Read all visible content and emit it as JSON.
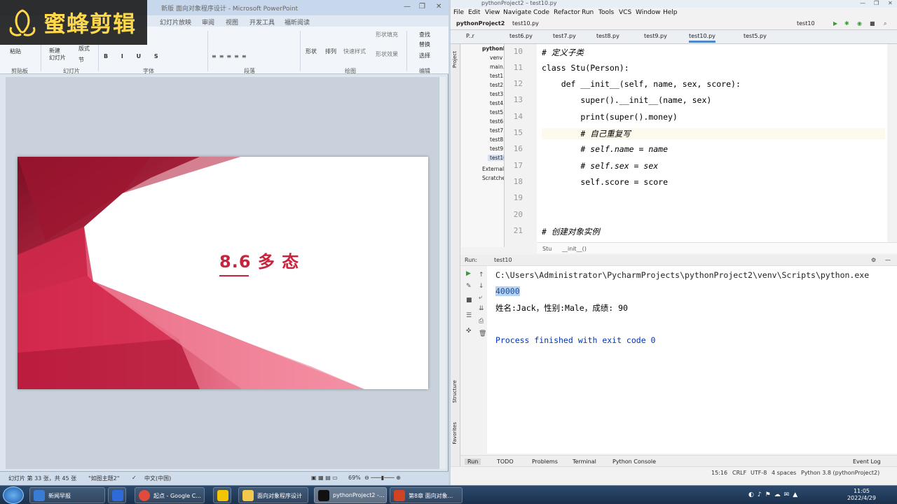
{
  "watermark": {
    "text": "蜜蜂剪辑"
  },
  "ppt": {
    "title": "新版 面向对象程序设计 - Microsoft PowerPoint",
    "tabs": [
      "幻灯片放映",
      "审阅",
      "视图",
      "开发工具",
      "福昕阅读"
    ],
    "ribbon": {
      "paste": "粘贴",
      "new_slide": "新建\n幻灯片",
      "layout": "版式",
      "section": "节",
      "shape": "形状",
      "arrange": "排列",
      "quick_style": "快速样式",
      "shape_fill": "形状填充",
      "shape_effect": "形状效果",
      "find": "查找",
      "replace": "替换",
      "select": "选择",
      "groups": [
        "剪贴板",
        "幻灯片",
        "字体",
        "段落",
        "绘图",
        "编辑"
      ]
    },
    "slide": {
      "title": "8.6 多 态"
    },
    "status": {
      "slide_info": "幻灯片 第 33 张，共 45 张",
      "theme": "\"如图主题2\"",
      "lang": "中文(中国)",
      "zoom": "69%"
    }
  },
  "pycharm": {
    "title": "pythonProject2 – test10.py",
    "menu": [
      "File",
      "Edit",
      "View",
      "Navigate",
      "Code",
      "Refactor",
      "Run",
      "Tools",
      "VCS",
      "Window",
      "Help"
    ],
    "nav": {
      "project": "pythonProject2",
      "file": "test10.py",
      "run_config": "test10"
    },
    "tabs": [
      "P..r",
      "test6.py",
      "test7.py",
      "test8.py",
      "test9.py",
      "test10.py",
      "test5.py"
    ],
    "active_tab": "test10.py",
    "tree": [
      "pythonP",
      "venv",
      "main.",
      "test1.",
      "test2.",
      "test3.",
      "test4.",
      "test5.",
      "test6.",
      "test7.",
      "test8.",
      "test9.",
      "test10",
      "External",
      "Scratche"
    ],
    "gutter_lines": [
      "10",
      "11",
      "12",
      "13",
      "14",
      "15",
      "16",
      "17",
      "18",
      "19",
      "20",
      "21"
    ],
    "code": [
      "# 定义子类",
      "class Stu(Person):",
      "    def __init__(self, name, sex, score):",
      "        super().__init__(name, sex)",
      "        print(super().money)",
      "        # 自己重复写",
      "        # self.name = name",
      "        # self.sex = sex",
      "        self.score = score",
      "",
      "",
      "# 创建对象实例"
    ],
    "breadcrumb": [
      "Stu",
      "__init__()"
    ],
    "run": {
      "label": "Run:",
      "config": "test10",
      "output": [
        "C:\\Users\\Administrator\\PycharmProjects\\pythonProject2\\venv\\Scripts\\python.exe",
        "40000",
        "姓名:Jack，性别:Male，成绩: 90",
        "",
        "Process finished with exit code 0"
      ]
    },
    "bottom_tabs": [
      "Run",
      "TODO",
      "Problems",
      "Terminal",
      "Python Console"
    ],
    "event_log": "Event Log",
    "status": {
      "position": "15:16",
      "eol": "CRLF",
      "encoding": "UTF-8",
      "indent": "4 spaces",
      "interpreter": "Python 3.8 (pythonProject2)"
    },
    "side_labels": {
      "project": "Project",
      "structure": "Structure",
      "favorites": "Favorites"
    }
  },
  "taskbar": {
    "items": [
      "新闻早报",
      "",
      "起点 - Google C...",
      "",
      "面向对象程序设计",
      "pythonProject2 -...",
      "第8章 面向对象..."
    ],
    "time": "11:05",
    "date": "2022/4/29"
  }
}
